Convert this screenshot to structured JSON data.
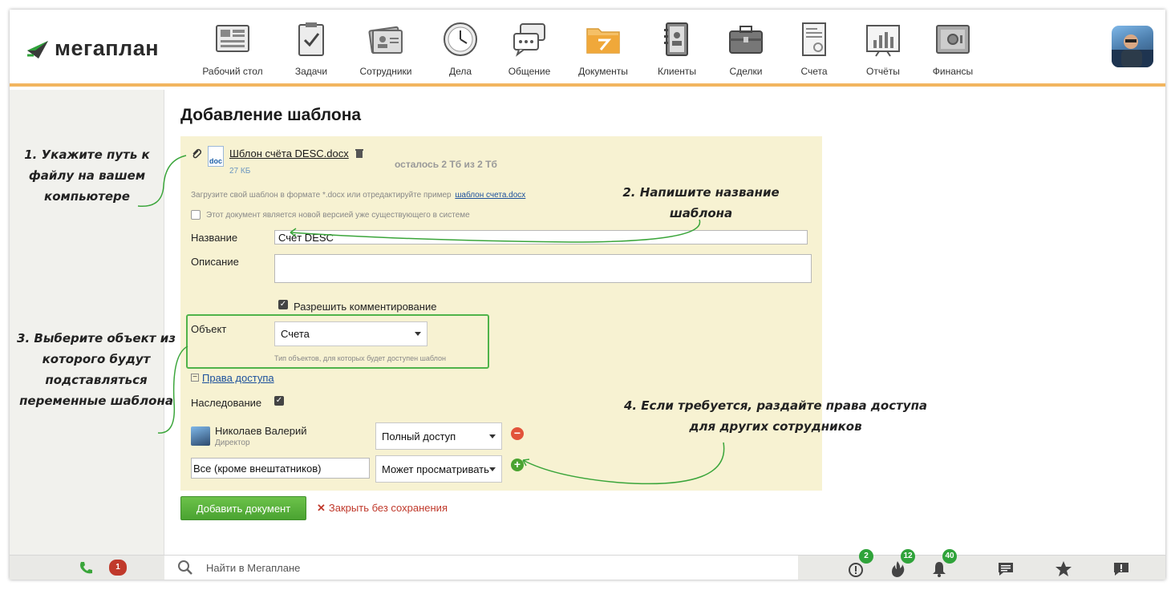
{
  "app": {
    "logo_text": "мегаплан"
  },
  "nav": {
    "items": [
      {
        "label": "Рабочий стол",
        "icon": "dashboard-icon"
      },
      {
        "label": "Задачи",
        "icon": "tasks-clipboard-icon"
      },
      {
        "label": "Сотрудники",
        "icon": "employees-card-icon"
      },
      {
        "label": "Дела",
        "icon": "clock-icon"
      },
      {
        "label": "Общение",
        "icon": "chat-bubbles-icon"
      },
      {
        "label": "Документы",
        "icon": "documents-folder-icon",
        "active": true
      },
      {
        "label": "Клиенты",
        "icon": "clients-notebook-icon"
      },
      {
        "label": "Сделки",
        "icon": "deals-briefcase-icon"
      },
      {
        "label": "Счета",
        "icon": "invoice-icon"
      },
      {
        "label": "Отчёты",
        "icon": "reports-chart-icon"
      },
      {
        "label": "Финансы",
        "icon": "finance-safe-icon"
      }
    ]
  },
  "page": {
    "title": "Добавление шаблона"
  },
  "file": {
    "name": "Шблон счёта DESC.docx",
    "size": "27 КБ",
    "type_badge": "doc",
    "quota": "осталось 2 Тб из 2 Тб",
    "hint_prefix": "Загрузите свой шаблон в формате *.docx или отредактируйте пример",
    "hint_link": "шаблон счета.docx",
    "new_version_label": "Этот документ является новой версией уже существующего в системе"
  },
  "form": {
    "name_label": "Название",
    "name_value": "Счёт DESC",
    "description_label": "Описание",
    "description_value": "",
    "allow_comments_label": "Разрешить комментирование",
    "allow_comments_checked": true,
    "object_label": "Объект",
    "object_value": "Счета",
    "object_hint": "Тип объектов, для которых будет доступен шаблон",
    "access_toggle": "Права доступа",
    "inherit_label": "Наследование",
    "inherit_checked": true
  },
  "access": {
    "user_name": "Николаев Валерий",
    "user_role": "Директор",
    "user_permission": "Полный доступ",
    "group_value": "Все (кроме внештатников)",
    "group_permission": "Может просматривать"
  },
  "actions": {
    "submit": "Добавить документ",
    "cancel": "Закрыть без сохранения"
  },
  "footer": {
    "phone_badge": "1",
    "search_placeholder": "Найти в Мегаплане",
    "alerts_badge": "2",
    "hot_badge": "12",
    "notifications_badge": "40"
  },
  "annotations": {
    "a1": [
      "1. Укажите путь к",
      "файлу на вашем",
      "компьютере"
    ],
    "a2": [
      "2. Напишите название",
      "шаблона"
    ],
    "a3": [
      "3. Выберите объект из",
      "которого будут",
      "подставляться",
      "переменные шаблона"
    ],
    "a4": [
      "4. Если требуется, раздайте права доступа",
      "для других сотрудников"
    ]
  },
  "colors": {
    "accent_orange": "#f2b55f",
    "panel_bg": "#f7f2d2",
    "green": "#4aa331",
    "annotation_green": "#3aa53a",
    "danger_red": "#e2533a"
  }
}
